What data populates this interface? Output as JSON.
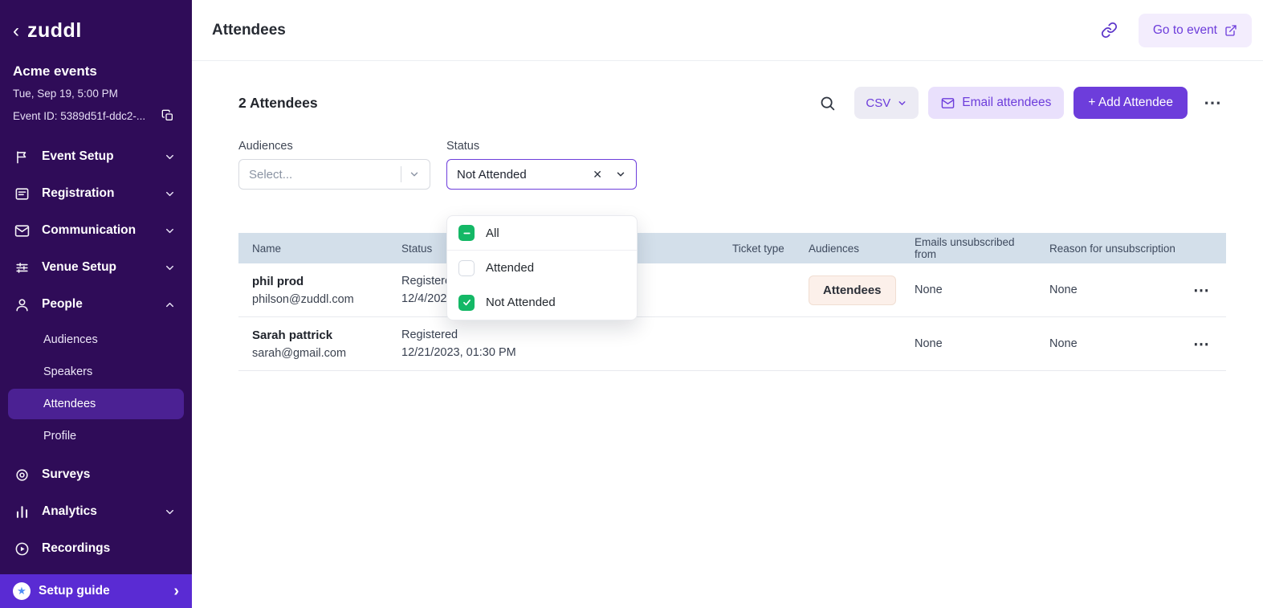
{
  "sidebar": {
    "logo": "zuddl",
    "event_name": "Acme events",
    "event_date": "Tue, Sep 19, 5:00 PM",
    "event_id": "Event ID: 5389d51f-ddc2-...",
    "nav": [
      {
        "label": "Event Setup"
      },
      {
        "label": "Registration"
      },
      {
        "label": "Communication"
      },
      {
        "label": "Venue Setup"
      },
      {
        "label": "People",
        "children": [
          "Audiences",
          "Speakers",
          "Attendees",
          "Profile"
        ],
        "selected_child": "Attendees"
      },
      {
        "label": "Surveys"
      },
      {
        "label": "Analytics"
      },
      {
        "label": "Recordings"
      }
    ],
    "setup_guide_label": "Setup guide"
  },
  "header": {
    "title": "Attendees",
    "go_to_event_label": "Go to event"
  },
  "toolbar": {
    "count": "2 Attendees",
    "csv_label": "CSV",
    "email_attendees_label": "Email attendees",
    "add_attendee_label": "+ Add Attendee",
    "more_label": "⋯"
  },
  "filters": {
    "audiences_label": "Audiences",
    "audiences_placeholder": "Select...",
    "status_label": "Status",
    "status_value": "Not Attended",
    "clear_icon": "✕"
  },
  "status_dropdown": {
    "options": [
      {
        "label": "All",
        "state": "indeterminate"
      },
      {
        "label": "Attended",
        "state": "unchecked"
      },
      {
        "label": "Not Attended",
        "state": "checked"
      }
    ]
  },
  "table": {
    "columns": {
      "name": "Name",
      "status": "Status",
      "ticket_type": "Ticket type",
      "audiences": "Audiences",
      "emails_unsubscribed": "Emails unsubscribed from",
      "reason": "Reason for unsubscription"
    },
    "rows": [
      {
        "name": "phil prod",
        "email": "philson@zuddl.com",
        "status": "Registered",
        "registered_at": "12/4/2023",
        "audience_badge": "Attendees",
        "emails_unsubscribed": "None",
        "reason": "None",
        "more_label": "⋯"
      },
      {
        "name": "Sarah pattrick",
        "email": "sarah@gmail.com",
        "status": "Registered",
        "registered_at": "12/21/2023, 01:30 PM",
        "audience_badge": "",
        "emails_unsubscribed": "None",
        "reason": "None",
        "more_label": "⋯"
      }
    ]
  },
  "colors": {
    "accent_purple": "#6d3ddb",
    "sidebar_bg": "#2f0c58",
    "sidebar_selected_bg": "#4b2193",
    "setup_guide_bg": "#5a2bd3",
    "table_header_bg": "#d3dfea",
    "checkbox_green": "#14b866",
    "badge_bg": "#fcf0ea"
  }
}
